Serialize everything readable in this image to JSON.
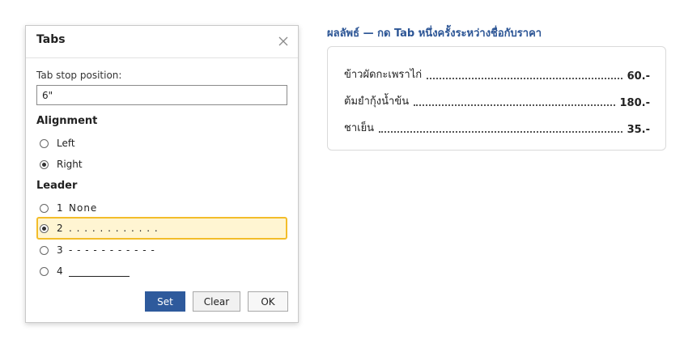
{
  "dialog": {
    "title": "Tabs",
    "close_icon": "close-icon",
    "tab_stop_label": "Tab stop position:",
    "tab_stop_value": "6\"",
    "alignment_heading": "Alignment",
    "alignment_options": [
      {
        "label": "Left",
        "checked": false
      },
      {
        "label": "Right",
        "checked": true
      }
    ],
    "leader_heading": "Leader",
    "leader_options": [
      {
        "num": "1",
        "label": "None",
        "checked": false
      },
      {
        "num": "2",
        "label": ". . . . . . . . . . . .",
        "checked": true
      },
      {
        "num": "3",
        "label": "- - - - - - - - - - -",
        "checked": false
      },
      {
        "num": "4",
        "label": "",
        "checked": false
      }
    ],
    "buttons": {
      "set": "Set",
      "clear": "Clear",
      "ok": "OK"
    },
    "highlight_color": "#f3bd2a",
    "primary_color": "#2e5a9c"
  },
  "preview": {
    "heading": "ผลลัพธ์ — กด Tab หนึ่งครั้งระหว่างชื่อกับราคา",
    "items": [
      {
        "name": "ข้าวผัดกะเพราไก่",
        "price": "60.-"
      },
      {
        "name": "ต้มยำกุ้งน้ำข้น",
        "price": "180.-"
      },
      {
        "name": "ชาเย็น",
        "price": "35.-"
      }
    ],
    "heading_color": "#2c5595"
  }
}
